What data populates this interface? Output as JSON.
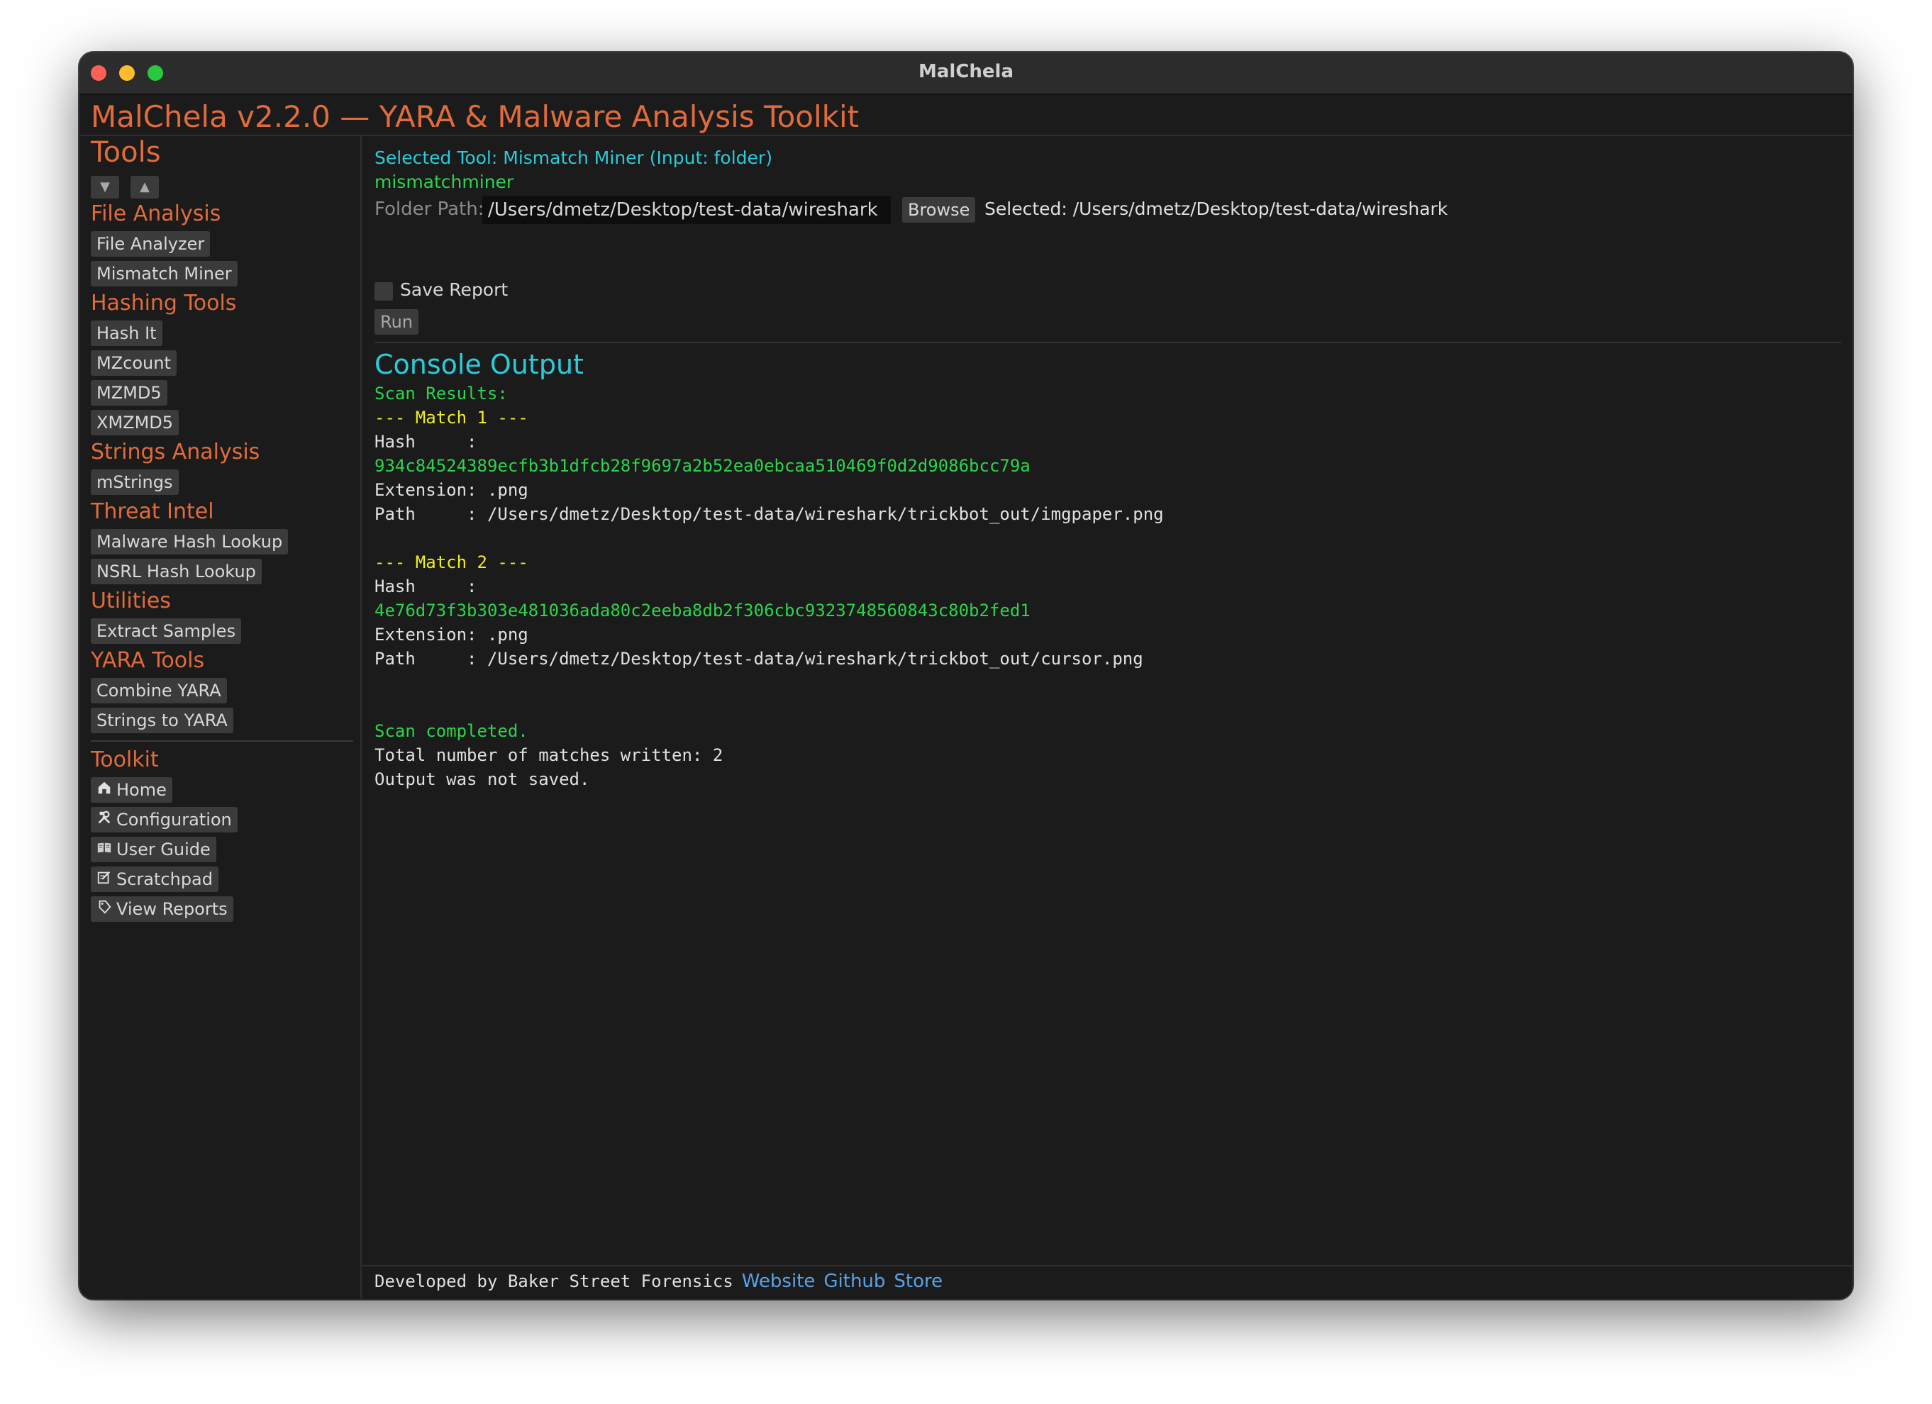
{
  "window": {
    "title": "MalChela"
  },
  "header": {
    "title": "MalChela v2.2.0 — YARA & Malware Analysis Toolkit"
  },
  "sidebar": {
    "tools_title": "Tools",
    "collapse_icon": "▼",
    "expand_icon": "▲",
    "categories": [
      {
        "title": "File Analysis",
        "items": [
          "File Analyzer",
          "Mismatch Miner"
        ]
      },
      {
        "title": "Hashing Tools",
        "items": [
          "Hash It",
          "MZcount",
          "MZMD5",
          "XMZMD5"
        ]
      },
      {
        "title": "Strings Analysis",
        "items": [
          "mStrings"
        ]
      },
      {
        "title": "Threat Intel",
        "items": [
          "Malware Hash Lookup",
          "NSRL Hash Lookup"
        ]
      },
      {
        "title": "Utilities",
        "items": [
          "Extract Samples"
        ]
      },
      {
        "title": "YARA Tools",
        "items": [
          "Combine YARA",
          "Strings to YARA"
        ]
      }
    ],
    "toolkit_title": "Toolkit",
    "toolkit": [
      {
        "icon": "home-icon",
        "label": "Home"
      },
      {
        "icon": "tools-icon",
        "label": "Configuration"
      },
      {
        "icon": "book-icon",
        "label": "User Guide"
      },
      {
        "icon": "notepad-icon",
        "label": "Scratchpad"
      },
      {
        "icon": "tag-icon",
        "label": "View Reports"
      }
    ]
  },
  "main": {
    "selected_tool": "Selected Tool: Mismatch Miner (Input: folder)",
    "command": "mismatchminer",
    "folder_label": "Folder Path:",
    "folder_value": "/Users/dmetz/Desktop/test-data/wireshark",
    "browse_label": "Browse",
    "selected_path": "Selected: /Users/dmetz/Desktop/test-data/wireshark",
    "save_report_label": "Save Report",
    "run_label": "Run"
  },
  "console": {
    "title": "Console Output",
    "lines": [
      {
        "text": "Scan Results:",
        "color": "green"
      },
      {
        "text": "--- Match 1 ---",
        "color": "yellow"
      },
      {
        "text": "Hash     :",
        "color": "white"
      },
      {
        "text": "934c84524389ecfb3b1dfcb28f9697a2b52ea0ebcaa510469f0d2d9086bcc79a",
        "color": "green"
      },
      {
        "text": "Extension: .png",
        "color": "white"
      },
      {
        "text": "Path     : /Users/dmetz/Desktop/test-data/wireshark/trickbot_out/imgpaper.png",
        "color": "white"
      },
      {
        "text": "",
        "color": "white"
      },
      {
        "text": "--- Match 2 ---",
        "color": "yellow"
      },
      {
        "text": "Hash     :",
        "color": "white"
      },
      {
        "text": "4e76d73f3b303e481036ada80c2eeba8db2f306cbc9323748560843c80b2fed1",
        "color": "green"
      },
      {
        "text": "Extension: .png",
        "color": "white"
      },
      {
        "text": "Path     : /Users/dmetz/Desktop/test-data/wireshark/trickbot_out/cursor.png",
        "color": "white"
      },
      {
        "text": "",
        "color": "white"
      },
      {
        "text": "",
        "color": "white"
      },
      {
        "text": "Scan completed.",
        "color": "green"
      },
      {
        "text": "Total number of matches written: 2",
        "color": "white"
      },
      {
        "text": "Output was not saved.",
        "color": "white"
      }
    ]
  },
  "footer": {
    "text": "Developed by Baker Street Forensics",
    "links": [
      "Website",
      "Github",
      "Store"
    ]
  },
  "colors": {
    "accent_orange": "#e06b3c",
    "cyan": "#2bcbd8",
    "console_green": "#2fd24d",
    "console_yellow": "#ecec2e",
    "link_blue": "#5aa2e6"
  }
}
